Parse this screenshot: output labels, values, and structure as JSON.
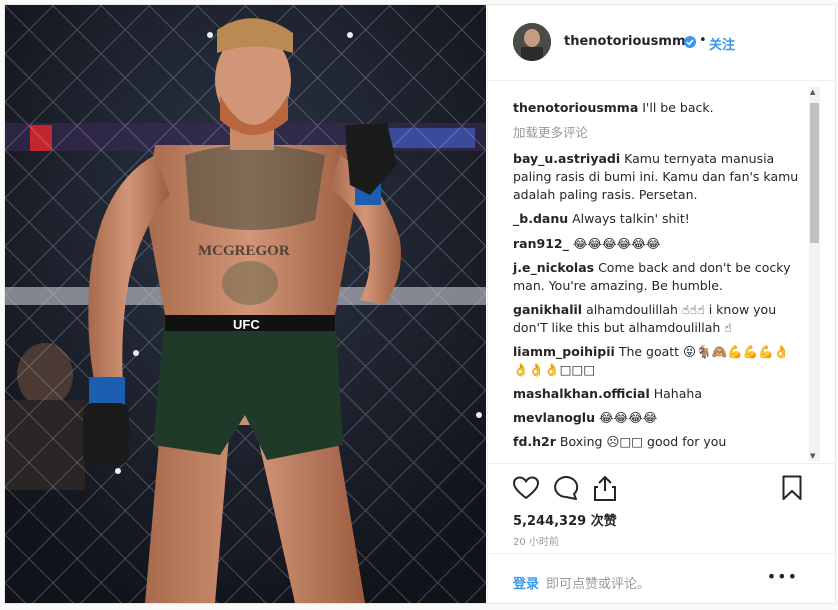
{
  "post": {
    "username": "thenotoriousmma",
    "separator": "•",
    "follow_label": "关注",
    "caption_user": "thenotoriousmma",
    "caption_text": "I'll be back.",
    "load_more": "加载更多评论",
    "likes": "5,244,329 次赞",
    "time": "20 小时前"
  },
  "comments": [
    {
      "user": "bay_u.astriyadi",
      "text": "Kamu ternyata manusia paling rasis di bumi ini. Kamu dan fan's kamu adalah paling rasis. Persetan."
    },
    {
      "user": "_b.danu",
      "text": "Always talkin' shit!"
    },
    {
      "user": "ran912_",
      "text": "😂😂😂😂😂😂"
    },
    {
      "user": "j.e_nickolas",
      "text": "Come back and don't be cocky man. You're amazing. Be humble."
    },
    {
      "user": "ganikhalil",
      "text": "alhamdoulillah ☝☝☝ i know you don'T like this but alhamdoulillah ☝"
    },
    {
      "user": "liamm_poihipii",
      "text": "The goatt 😝🐐🙈💪💪💪👌👌👌👌□□□"
    },
    {
      "user": "mashalkhan.official",
      "text": "Hahaha"
    },
    {
      "user": "mevlanoglu",
      "text": "😂😂😂😂"
    },
    {
      "user": "fd.h2r",
      "text": "Boxing ☹□□ good for you"
    }
  ],
  "photo": {
    "chest_text": "MCGREGOR",
    "brand_text": "UFC"
  },
  "footer": {
    "login": "登录",
    "hint": "即可点赞或评论。",
    "more": "•••"
  },
  "icons": [
    "heart-icon",
    "comment-icon",
    "share-icon",
    "bookmark-icon",
    "verified-icon",
    "more-icon"
  ],
  "colors": {
    "accent": "#3897f0",
    "text": "#262626",
    "muted": "#999999"
  }
}
